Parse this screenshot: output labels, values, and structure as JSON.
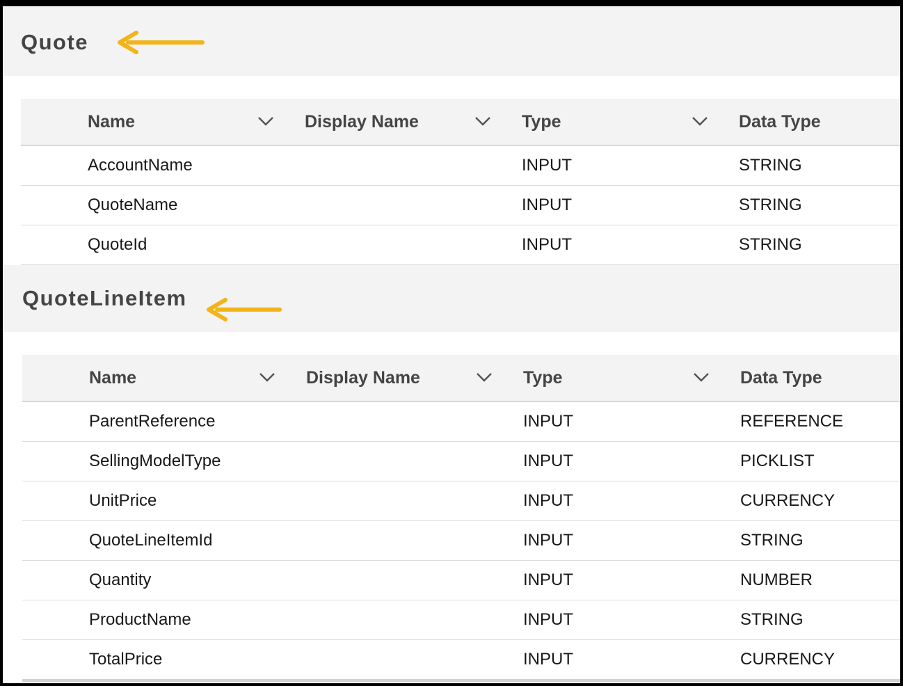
{
  "sections": [
    {
      "title": "Quote",
      "columns": [
        "Name",
        "Display Name",
        "Type",
        "Data Type"
      ],
      "rows": [
        {
          "name": "AccountName",
          "display_name": "",
          "type": "INPUT",
          "data_type": "STRING"
        },
        {
          "name": "QuoteName",
          "display_name": "",
          "type": "INPUT",
          "data_type": "STRING"
        },
        {
          "name": "QuoteId",
          "display_name": "",
          "type": "INPUT",
          "data_type": "STRING"
        }
      ]
    },
    {
      "title": "QuoteLineItem",
      "columns": [
        "Name",
        "Display Name",
        "Type",
        "Data Type"
      ],
      "rows": [
        {
          "name": "ParentReference",
          "display_name": "",
          "type": "INPUT",
          "data_type": "REFERENCE"
        },
        {
          "name": "SellingModelType",
          "display_name": "",
          "type": "INPUT",
          "data_type": "PICKLIST"
        },
        {
          "name": "UnitPrice",
          "display_name": "",
          "type": "INPUT",
          "data_type": "CURRENCY"
        },
        {
          "name": "QuoteLineItemId",
          "display_name": "",
          "type": "INPUT",
          "data_type": "STRING"
        },
        {
          "name": "Quantity",
          "display_name": "",
          "type": "INPUT",
          "data_type": "NUMBER"
        },
        {
          "name": "ProductName",
          "display_name": "",
          "type": "INPUT",
          "data_type": "STRING"
        },
        {
          "name": "TotalPrice",
          "display_name": "",
          "type": "INPUT",
          "data_type": "CURRENCY"
        }
      ]
    }
  ],
  "icons": {
    "arrow": "left-arrow-icon",
    "sort": "chevron-down-icon"
  },
  "colors": {
    "arrow": "#f2b418",
    "header_bg": "#f3f3f3",
    "title_text": "#444444"
  }
}
